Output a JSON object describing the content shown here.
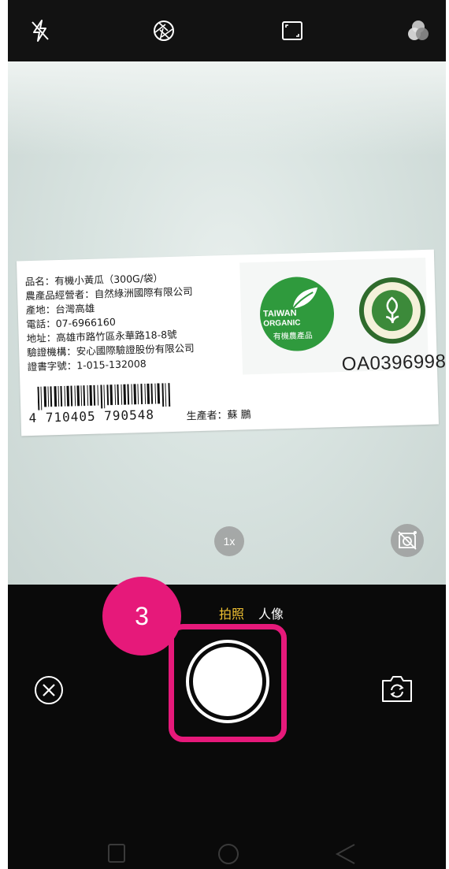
{
  "top_toolbar": {
    "icons": [
      "flash-off-icon",
      "aperture-icon",
      "aspect-ratio-icon",
      "filter-icon"
    ]
  },
  "viewfinder": {
    "label": {
      "lines": [
        "品名：有機小黃瓜（300G/袋）",
        "農產品經營者：自然綠洲國際有限公司",
        "產地：台灣高雄",
        "電話：07-6966160",
        "地址：高雄市路竹區永華路18-8號",
        "驗證機構：安心國際驗證股份有限公司",
        "證書字號：1-015-132008"
      ],
      "barcode_number": "4 710405 790548",
      "producer": "生產者：蘇 鵬",
      "organic_mark": {
        "line1": "TAIWAN",
        "line2": "ORGANIC",
        "line3": "有機農產品"
      },
      "cert_number": "OA0396998"
    },
    "zoom_label": "1x",
    "ai_icon": "ai-scene-off-icon"
  },
  "bottom": {
    "modes": {
      "photo": "拍照",
      "portrait": "人像"
    },
    "active_mode": "photo",
    "step_marker": "3"
  },
  "colors": {
    "accent": "#e6197a",
    "mode_active": "#f1c232",
    "organic_green": "#2f9a3d"
  }
}
